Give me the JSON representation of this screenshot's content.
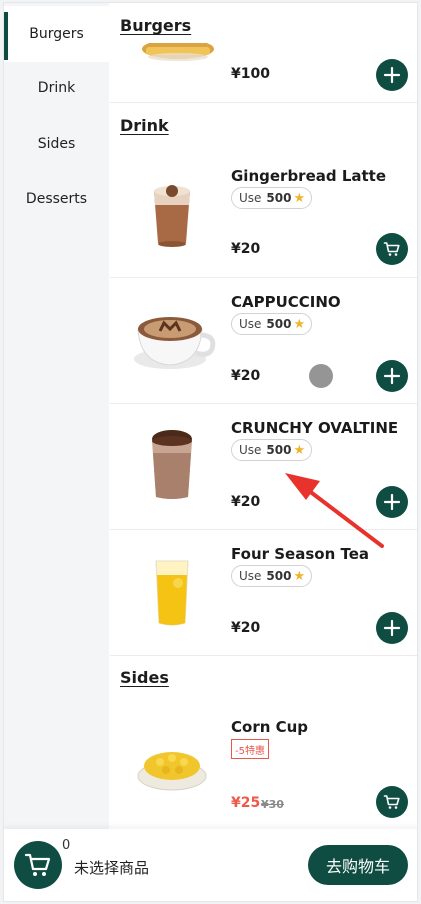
{
  "sidebar": {
    "items": [
      {
        "label": "Burgers",
        "active": true
      },
      {
        "label": "Drink",
        "active": false
      },
      {
        "label": "Sides",
        "active": false
      },
      {
        "label": "Desserts",
        "active": false
      }
    ]
  },
  "sections": {
    "burgers": {
      "title": "Burgers",
      "partial_item": {
        "price": "¥100",
        "action": "add"
      }
    },
    "drink": {
      "title": "Drink",
      "items": [
        {
          "name": "Gingerbread Latte",
          "points_label": "Use",
          "points": "500",
          "price": "¥20",
          "action": "cart",
          "icon": "gingerbread-latte-image"
        },
        {
          "name": "CAPPUCCINO",
          "points_label": "Use",
          "points": "500",
          "price": "¥20",
          "action": "add",
          "icon": "cappuccino-image"
        },
        {
          "name": "CRUNCHY OVALTINE",
          "points_label": "Use",
          "points": "500",
          "price": "¥20",
          "action": "add",
          "icon": "ovaltine-image"
        },
        {
          "name": "Four Season Tea",
          "points_label": "Use",
          "points": "500",
          "price": "¥20",
          "action": "add",
          "icon": "four-season-tea-image"
        }
      ]
    },
    "sides": {
      "title": "Sides",
      "items": [
        {
          "name": "Corn Cup",
          "promo": "-5特惠",
          "price": "¥25",
          "old_price": "¥30",
          "action": "cart",
          "icon": "corn-cup-image"
        }
      ]
    }
  },
  "cart": {
    "count": "0",
    "status": "未选择商品",
    "checkout_label": "去购物车"
  },
  "colors": {
    "brand_green": "#0f4d42",
    "promo_red": "#ee5a48",
    "star": "#f0b429",
    "annotation_red": "#e8322c"
  }
}
